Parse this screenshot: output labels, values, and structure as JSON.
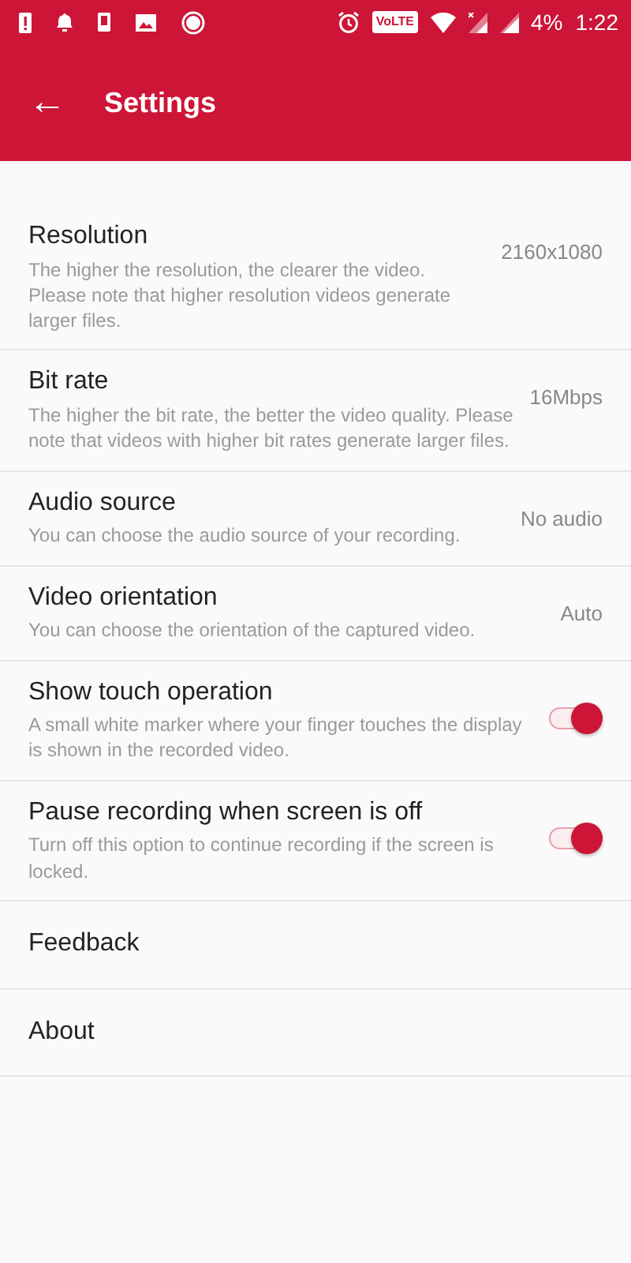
{
  "status_bar": {
    "volte": "VoLTE",
    "battery": "4%",
    "time": "1:22"
  },
  "app_bar": {
    "back": "←",
    "title": "Settings"
  },
  "settings": [
    {
      "kind": "value",
      "title": "Resolution",
      "description": "The higher the resolution, the clearer the video. Please note that higher resolution videos generate larger files.",
      "value": "2160x1080"
    },
    {
      "kind": "value",
      "title": "Bit rate",
      "description": "The higher the bit rate, the better the video quality. Please note that videos with higher bit rates generate larger files.",
      "value": "16Mbps"
    },
    {
      "kind": "value",
      "title": "Audio source",
      "description": "You can choose the audio source of your recording.",
      "value": "No audio"
    },
    {
      "kind": "value",
      "title": "Video orientation",
      "description": "You can choose the orientation of the captured video.",
      "value": "Auto"
    },
    {
      "kind": "switch",
      "title": "Show touch operation",
      "description": "A small white marker where your finger touches the display is shown in the recorded video.",
      "on": true
    },
    {
      "kind": "switch",
      "title": "Pause recording when screen is off",
      "description": "Turn off this option to continue recording if the screen is locked.",
      "on": true
    },
    {
      "kind": "plain",
      "title": "Feedback"
    },
    {
      "kind": "plain",
      "title": "About"
    }
  ]
}
